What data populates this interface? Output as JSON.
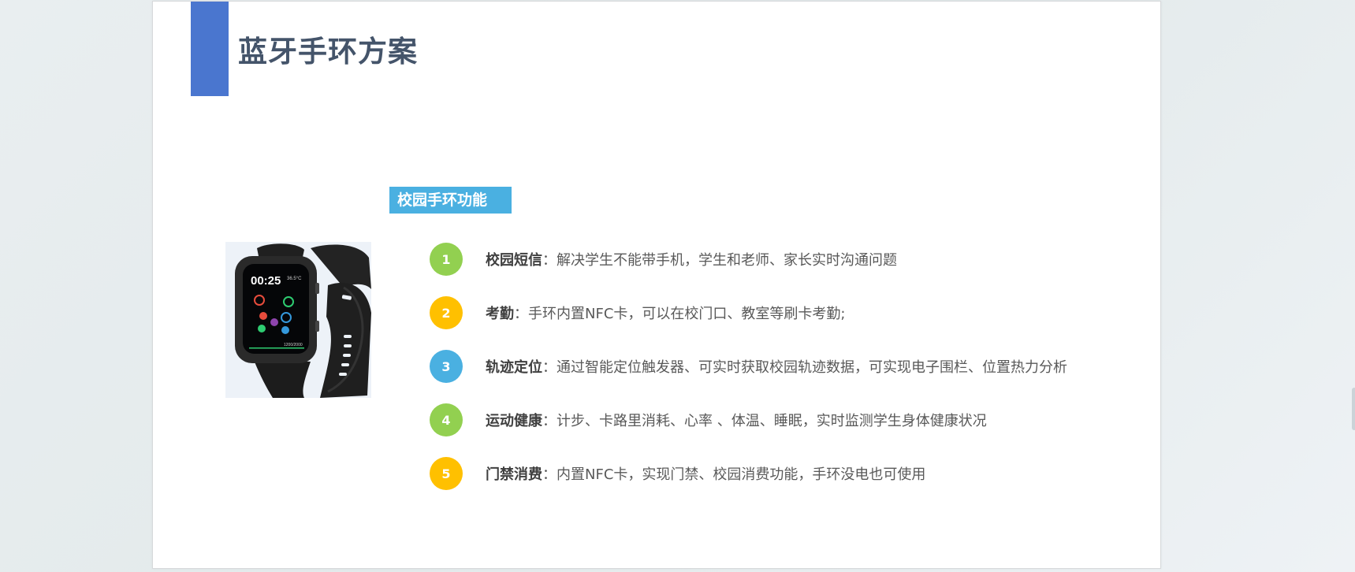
{
  "slide": {
    "title": "蓝牙手环方案",
    "section_label": "校园手环功能",
    "watch_screen": {
      "time": "00:25",
      "temperature": "36.5°C",
      "steps": "1200/2000"
    },
    "features": [
      {
        "num": "1",
        "name": "校园短信",
        "sep": "：",
        "desc": "解决学生不能带手机，学生和老师、家长实时沟通问题",
        "color": "#92d050"
      },
      {
        "num": "2",
        "name": "考勤",
        "sep": "：",
        "desc": "手环内置NFC卡，可以在校门口、教室等刷卡考勤;",
        "color": "#ffc000"
      },
      {
        "num": "3",
        "name": "轨迹定位",
        "sep": "：",
        "desc": "通过智能定位触发器、可实时获取校园轨迹数据，可实现电子围栏、位置热力分析",
        "color": "#4ab0e1"
      },
      {
        "num": "4",
        "name": "运动健康",
        "sep": "：",
        "desc": "计步、卡路里消耗、心率 、体温、睡眠，实时监测学生身体健康状况",
        "color": "#92d050"
      },
      {
        "num": "5",
        "name": "门禁消费",
        "sep": "：",
        "desc": "内置NFC卡，实现门禁、校园消费功能，手环没电也可使用",
        "color": "#ffc000"
      }
    ]
  }
}
